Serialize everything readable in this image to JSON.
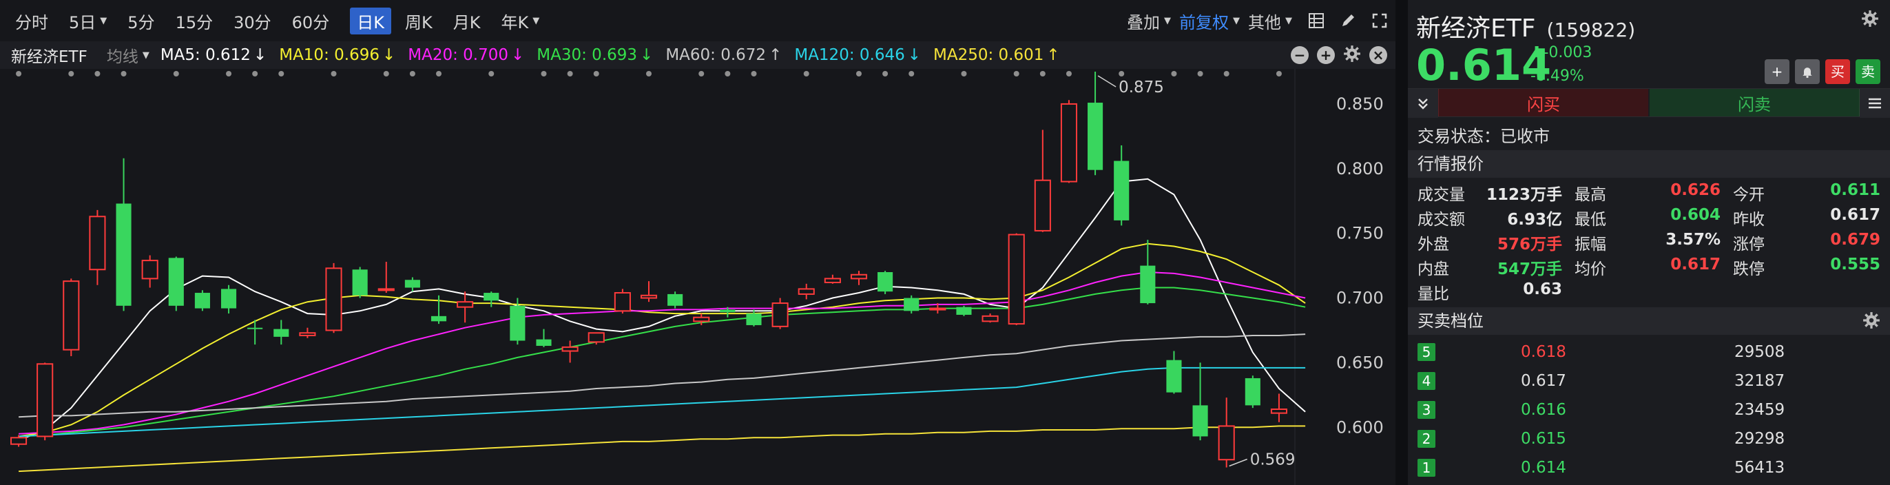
{
  "colors": {
    "up": "#ff3b3b",
    "down": "#39d65e",
    "bg": "#16171b",
    "ma5": "#ffffff",
    "ma10": "#f4f030",
    "ma20": "#ff22ff",
    "ma30": "#35e04a",
    "ma60": "#c8c8c8",
    "ma120": "#2ad4e8",
    "ma250": "#f6e33a",
    "accent_blue": "#3f8cff"
  },
  "toolbar": {
    "periods": [
      {
        "label": "分时",
        "caret": false
      },
      {
        "label": "5日",
        "caret": true
      },
      {
        "label": "5分",
        "caret": false
      },
      {
        "label": "15分",
        "caret": false
      },
      {
        "label": "30分",
        "caret": false
      },
      {
        "label": "60分",
        "caret": false
      },
      {
        "label": "日K",
        "caret": false,
        "active": true
      },
      {
        "label": "周K",
        "caret": false
      },
      {
        "label": "月K",
        "caret": false
      },
      {
        "label": "年K",
        "caret": true
      }
    ],
    "overlay_label": "叠加",
    "adjust_label": "前复权",
    "other_label": "其他",
    "icons": [
      "layout-icon",
      "pen-icon",
      "fullscreen-icon"
    ]
  },
  "ma_bar": {
    "stock_name": "新经济ETF",
    "ma_type": "均线",
    "items": [
      {
        "label": "MA5: 0.612",
        "arrow": "↓",
        "color": "#ffffff"
      },
      {
        "label": "MA10: 0.696",
        "arrow": "↓",
        "color": "#f4f030"
      },
      {
        "label": "MA20: 0.700",
        "arrow": "↓",
        "color": "#ff22ff"
      },
      {
        "label": "MA30: 0.693",
        "arrow": "↓",
        "color": "#35e04a"
      },
      {
        "label": "MA60: 0.672",
        "arrow": "↑",
        "color": "#c8c8c8"
      },
      {
        "label": "MA120: 0.646",
        "arrow": "↓",
        "color": "#2ad4e8"
      },
      {
        "label": "MA250: 0.601",
        "arrow": "↑",
        "color": "#f6e33a"
      }
    ]
  },
  "chart_data": {
    "type": "candlestick",
    "ylim": [
      0.565,
      0.875
    ],
    "y_ticks": [
      "0.850",
      "0.800",
      "0.750",
      "0.700",
      "0.650",
      "0.600"
    ],
    "y_tick_values": [
      0.85,
      0.8,
      0.75,
      0.7,
      0.65,
      0.6
    ],
    "high_annotation": "0.875",
    "low_annotation": "0.569",
    "high_value": 0.875,
    "low_value": 0.569,
    "candles": [
      {
        "o": 0.587,
        "h": 0.594,
        "l": 0.585,
        "c": 0.592
      },
      {
        "o": 0.593,
        "h": 0.65,
        "l": 0.59,
        "c": 0.649
      },
      {
        "o": 0.66,
        "h": 0.715,
        "l": 0.655,
        "c": 0.713
      },
      {
        "o": 0.722,
        "h": 0.768,
        "l": 0.71,
        "c": 0.763
      },
      {
        "o": 0.773,
        "h": 0.808,
        "l": 0.69,
        "c": 0.694
      },
      {
        "o": 0.715,
        "h": 0.733,
        "l": 0.708,
        "c": 0.729
      },
      {
        "o": 0.731,
        "h": 0.732,
        "l": 0.69,
        "c": 0.694
      },
      {
        "o": 0.704,
        "h": 0.706,
        "l": 0.69,
        "c": 0.692
      },
      {
        "o": 0.707,
        "h": 0.71,
        "l": 0.688,
        "c": 0.692
      },
      {
        "o": 0.677,
        "h": 0.683,
        "l": 0.664,
        "c": 0.676
      },
      {
        "o": 0.676,
        "h": 0.683,
        "l": 0.664,
        "c": 0.67
      },
      {
        "o": 0.671,
        "h": 0.677,
        "l": 0.669,
        "c": 0.673
      },
      {
        "o": 0.675,
        "h": 0.727,
        "l": 0.673,
        "c": 0.723
      },
      {
        "o": 0.722,
        "h": 0.724,
        "l": 0.7,
        "c": 0.702
      },
      {
        "o": 0.707,
        "h": 0.728,
        "l": 0.704,
        "c": 0.707
      },
      {
        "o": 0.714,
        "h": 0.716,
        "l": 0.705,
        "c": 0.708
      },
      {
        "o": 0.686,
        "h": 0.702,
        "l": 0.68,
        "c": 0.682
      },
      {
        "o": 0.693,
        "h": 0.705,
        "l": 0.681,
        "c": 0.697
      },
      {
        "o": 0.704,
        "h": 0.705,
        "l": 0.693,
        "c": 0.698
      },
      {
        "o": 0.694,
        "h": 0.7,
        "l": 0.664,
        "c": 0.667
      },
      {
        "o": 0.668,
        "h": 0.676,
        "l": 0.662,
        "c": 0.663
      },
      {
        "o": 0.659,
        "h": 0.667,
        "l": 0.65,
        "c": 0.662
      },
      {
        "o": 0.666,
        "h": 0.673,
        "l": 0.664,
        "c": 0.673
      },
      {
        "o": 0.69,
        "h": 0.707,
        "l": 0.688,
        "c": 0.704
      },
      {
        "o": 0.7,
        "h": 0.713,
        "l": 0.697,
        "c": 0.702
      },
      {
        "o": 0.703,
        "h": 0.705,
        "l": 0.692,
        "c": 0.694
      },
      {
        "o": 0.682,
        "h": 0.688,
        "l": 0.679,
        "c": 0.685
      },
      {
        "o": 0.691,
        "h": 0.693,
        "l": 0.685,
        "c": 0.689
      },
      {
        "o": 0.688,
        "h": 0.691,
        "l": 0.678,
        "c": 0.679
      },
      {
        "o": 0.678,
        "h": 0.7,
        "l": 0.676,
        "c": 0.696
      },
      {
        "o": 0.703,
        "h": 0.711,
        "l": 0.699,
        "c": 0.707
      },
      {
        "o": 0.712,
        "h": 0.718,
        "l": 0.711,
        "c": 0.715
      },
      {
        "o": 0.715,
        "h": 0.721,
        "l": 0.71,
        "c": 0.718
      },
      {
        "o": 0.72,
        "h": 0.721,
        "l": 0.703,
        "c": 0.705
      },
      {
        "o": 0.7,
        "h": 0.702,
        "l": 0.688,
        "c": 0.69
      },
      {
        "o": 0.692,
        "h": 0.696,
        "l": 0.688,
        "c": 0.692
      },
      {
        "o": 0.693,
        "h": 0.694,
        "l": 0.686,
        "c": 0.687
      },
      {
        "o": 0.682,
        "h": 0.688,
        "l": 0.681,
        "c": 0.686
      },
      {
        "o": 0.68,
        "h": 0.75,
        "l": 0.679,
        "c": 0.749
      },
      {
        "o": 0.752,
        "h": 0.83,
        "l": 0.751,
        "c": 0.791
      },
      {
        "o": 0.79,
        "h": 0.853,
        "l": 0.789,
        "c": 0.85
      },
      {
        "o": 0.851,
        "h": 0.875,
        "l": 0.795,
        "c": 0.799
      },
      {
        "o": 0.806,
        "h": 0.818,
        "l": 0.756,
        "c": 0.76
      },
      {
        "o": 0.725,
        "h": 0.745,
        "l": 0.695,
        "c": 0.696
      },
      {
        "o": 0.652,
        "h": 0.659,
        "l": 0.626,
        "c": 0.627
      },
      {
        "o": 0.617,
        "h": 0.65,
        "l": 0.59,
        "c": 0.593
      },
      {
        "o": 0.575,
        "h": 0.623,
        "l": 0.569,
        "c": 0.601
      },
      {
        "o": 0.638,
        "h": 0.64,
        "l": 0.615,
        "c": 0.617
      },
      {
        "o": 0.611,
        "h": 0.626,
        "l": 0.604,
        "c": 0.614
      }
    ],
    "series": [
      {
        "name": "MA5",
        "values": [
          0.59,
          0.598,
          0.615,
          0.64,
          0.665,
          0.69,
          0.707,
          0.717,
          0.716,
          0.705,
          0.697,
          0.688,
          0.687,
          0.69,
          0.695,
          0.705,
          0.707,
          0.703,
          0.7,
          0.694,
          0.69,
          0.682,
          0.676,
          0.674,
          0.678,
          0.686,
          0.69,
          0.69,
          0.69,
          0.69,
          0.694,
          0.7,
          0.704,
          0.709,
          0.708,
          0.706,
          0.703,
          0.695,
          0.692,
          0.708,
          0.735,
          0.762,
          0.79,
          0.792,
          0.78,
          0.745,
          0.7,
          0.658,
          0.63,
          0.612
        ]
      },
      {
        "name": "MA10",
        "values": [
          0.593,
          0.596,
          0.602,
          0.612,
          0.625,
          0.637,
          0.649,
          0.661,
          0.672,
          0.682,
          0.691,
          0.697,
          0.7,
          0.702,
          0.701,
          0.699,
          0.698,
          0.696,
          0.696,
          0.695,
          0.694,
          0.693,
          0.692,
          0.691,
          0.689,
          0.688,
          0.688,
          0.688,
          0.688,
          0.689,
          0.691,
          0.693,
          0.696,
          0.698,
          0.699,
          0.7,
          0.7,
          0.699,
          0.7,
          0.706,
          0.716,
          0.727,
          0.738,
          0.742,
          0.74,
          0.736,
          0.73,
          0.72,
          0.71,
          0.696
        ]
      },
      {
        "name": "MA20",
        "values": [
          0.595,
          0.596,
          0.597,
          0.599,
          0.602,
          0.606,
          0.61,
          0.615,
          0.62,
          0.626,
          0.633,
          0.64,
          0.647,
          0.654,
          0.661,
          0.667,
          0.672,
          0.677,
          0.681,
          0.685,
          0.687,
          0.688,
          0.689,
          0.69,
          0.69,
          0.691,
          0.691,
          0.692,
          0.692,
          0.692,
          0.692,
          0.692,
          0.693,
          0.694,
          0.694,
          0.695,
          0.695,
          0.696,
          0.697,
          0.701,
          0.706,
          0.712,
          0.717,
          0.72,
          0.719,
          0.716,
          0.712,
          0.708,
          0.704,
          0.7
        ]
      },
      {
        "name": "MA30",
        "values": [
          0.593,
          0.594,
          0.596,
          0.598,
          0.6,
          0.603,
          0.606,
          0.609,
          0.612,
          0.615,
          0.618,
          0.621,
          0.624,
          0.628,
          0.632,
          0.636,
          0.64,
          0.645,
          0.649,
          0.654,
          0.658,
          0.662,
          0.666,
          0.67,
          0.674,
          0.678,
          0.681,
          0.683,
          0.685,
          0.687,
          0.688,
          0.689,
          0.69,
          0.691,
          0.691,
          0.692,
          0.692,
          0.692,
          0.692,
          0.695,
          0.699,
          0.703,
          0.706,
          0.708,
          0.708,
          0.706,
          0.703,
          0.7,
          0.697,
          0.693
        ]
      },
      {
        "name": "MA60",
        "values": [
          0.608,
          0.609,
          0.609,
          0.61,
          0.611,
          0.612,
          0.612,
          0.613,
          0.614,
          0.615,
          0.616,
          0.617,
          0.618,
          0.619,
          0.62,
          0.622,
          0.623,
          0.624,
          0.625,
          0.626,
          0.627,
          0.628,
          0.63,
          0.631,
          0.632,
          0.634,
          0.635,
          0.637,
          0.638,
          0.64,
          0.642,
          0.644,
          0.646,
          0.648,
          0.65,
          0.652,
          0.654,
          0.656,
          0.657,
          0.66,
          0.663,
          0.665,
          0.667,
          0.668,
          0.669,
          0.67,
          0.67,
          0.671,
          0.671,
          0.672
        ]
      },
      {
        "name": "MA120",
        "values": [
          0.593,
          0.594,
          0.595,
          0.596,
          0.597,
          0.598,
          0.599,
          0.6,
          0.601,
          0.602,
          0.603,
          0.604,
          0.605,
          0.606,
          0.607,
          0.608,
          0.609,
          0.61,
          0.611,
          0.612,
          0.613,
          0.614,
          0.615,
          0.616,
          0.617,
          0.618,
          0.619,
          0.62,
          0.621,
          0.622,
          0.623,
          0.624,
          0.625,
          0.626,
          0.627,
          0.628,
          0.629,
          0.63,
          0.631,
          0.634,
          0.637,
          0.64,
          0.643,
          0.645,
          0.646,
          0.646,
          0.646,
          0.646,
          0.646,
          0.646
        ]
      },
      {
        "name": "MA250",
        "values": [
          0.566,
          0.567,
          0.568,
          0.569,
          0.57,
          0.571,
          0.572,
          0.573,
          0.574,
          0.575,
          0.576,
          0.577,
          0.578,
          0.579,
          0.58,
          0.581,
          0.582,
          0.583,
          0.584,
          0.585,
          0.586,
          0.587,
          0.588,
          0.589,
          0.589,
          0.59,
          0.591,
          0.591,
          0.592,
          0.592,
          0.593,
          0.594,
          0.594,
          0.595,
          0.595,
          0.596,
          0.596,
          0.597,
          0.597,
          0.598,
          0.598,
          0.598,
          0.599,
          0.599,
          0.599,
          0.6,
          0.6,
          0.6,
          0.601,
          0.601
        ]
      }
    ]
  },
  "quote": {
    "name": "新经济ETF",
    "code": "(159822)",
    "price": "0.614",
    "change": "-0.003",
    "change_pct": "-0.49%",
    "flash_buy": "闪买",
    "flash_sell": "闪卖",
    "status": "交易状态：已收市",
    "section_quote": "行情报价",
    "section_book": "买卖档位",
    "rows": [
      [
        {
          "label": "成交量",
          "value": "1123万手",
          "color": "#e8e8e8"
        },
        {
          "label": "最高",
          "value": "0.626",
          "color": "#ff4545"
        },
        {
          "label": "今开",
          "value": "0.611",
          "color": "#3ddc65"
        }
      ],
      [
        {
          "label": "成交额",
          "value": "6.93亿",
          "color": "#e8e8e8"
        },
        {
          "label": "最低",
          "value": "0.604",
          "color": "#3ddc65"
        },
        {
          "label": "昨收",
          "value": "0.617",
          "color": "#e8e8e8"
        }
      ],
      [
        {
          "label": "外盘",
          "value": "576万手",
          "color": "#ff4545"
        },
        {
          "label": "振幅",
          "value": "3.57%",
          "color": "#e8e8e8"
        },
        {
          "label": "涨停",
          "value": "0.679",
          "color": "#ff4545"
        }
      ],
      [
        {
          "label": "内盘",
          "value": "547万手",
          "color": "#3ddc65"
        },
        {
          "label": "均价",
          "value": "0.617",
          "color": "#ff4545"
        },
        {
          "label": "跌停",
          "value": "0.555",
          "color": "#3ddc65"
        }
      ],
      [
        {
          "label": "量比",
          "value": "0.63",
          "color": "#e8e8e8"
        },
        {
          "label": "",
          "value": "",
          "color": "#e8e8e8"
        },
        {
          "label": "",
          "value": "",
          "color": "#e8e8e8"
        }
      ]
    ],
    "book": [
      {
        "level": "5",
        "price": "0.618",
        "volume": "29508",
        "color": "#ff4545"
      },
      {
        "level": "4",
        "price": "0.617",
        "volume": "32187",
        "color": "#e0e0e0"
      },
      {
        "level": "3",
        "price": "0.616",
        "volume": "23459",
        "color": "#3ddc65"
      },
      {
        "level": "2",
        "price": "0.615",
        "volume": "29298",
        "color": "#3ddc65"
      },
      {
        "level": "1",
        "price": "0.614",
        "volume": "56413",
        "color": "#3ddc65"
      }
    ]
  }
}
